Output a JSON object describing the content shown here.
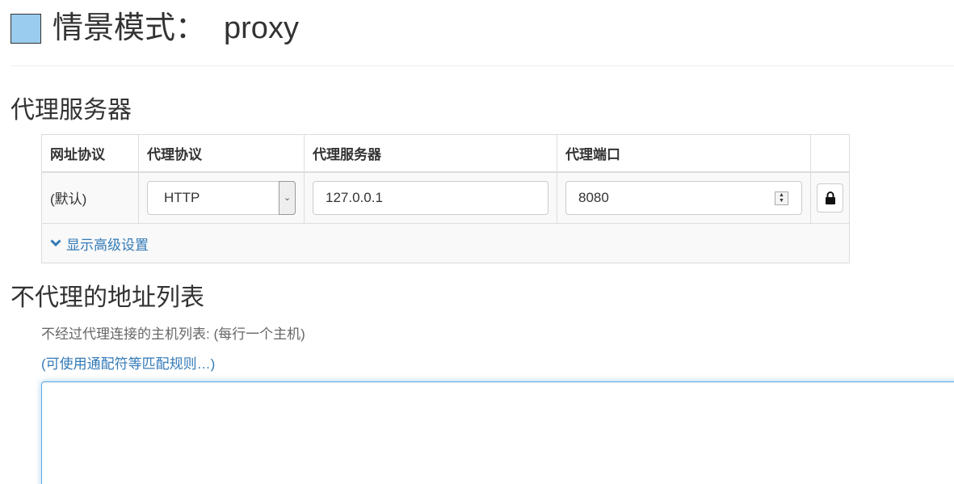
{
  "profile": {
    "color": "#99ccee",
    "title_label": "情景模式：",
    "name": "proxy"
  },
  "proxy_servers": {
    "heading": "代理服务器",
    "columns": [
      "网址协议",
      "代理协议",
      "代理服务器",
      "代理端口"
    ],
    "rule": {
      "scheme": "(默认)",
      "protocol": "HTTP",
      "host": "127.0.0.1",
      "port": "8080"
    },
    "advanced_link": "显示高级设置",
    "icons": {
      "advanced": "chevron-down-icon",
      "lock": "lock-icon",
      "spinner": "spinner-icon"
    }
  },
  "bypass": {
    "heading": "不代理的地址列表",
    "help_text": "不经过代理连接的主机列表: (每行一个主机)",
    "wildcard_link": "(可使用通配符等匹配规则…)",
    "list_value": ""
  },
  "colors": {
    "link": "#337ab7",
    "focus_border": "#66afe9"
  }
}
